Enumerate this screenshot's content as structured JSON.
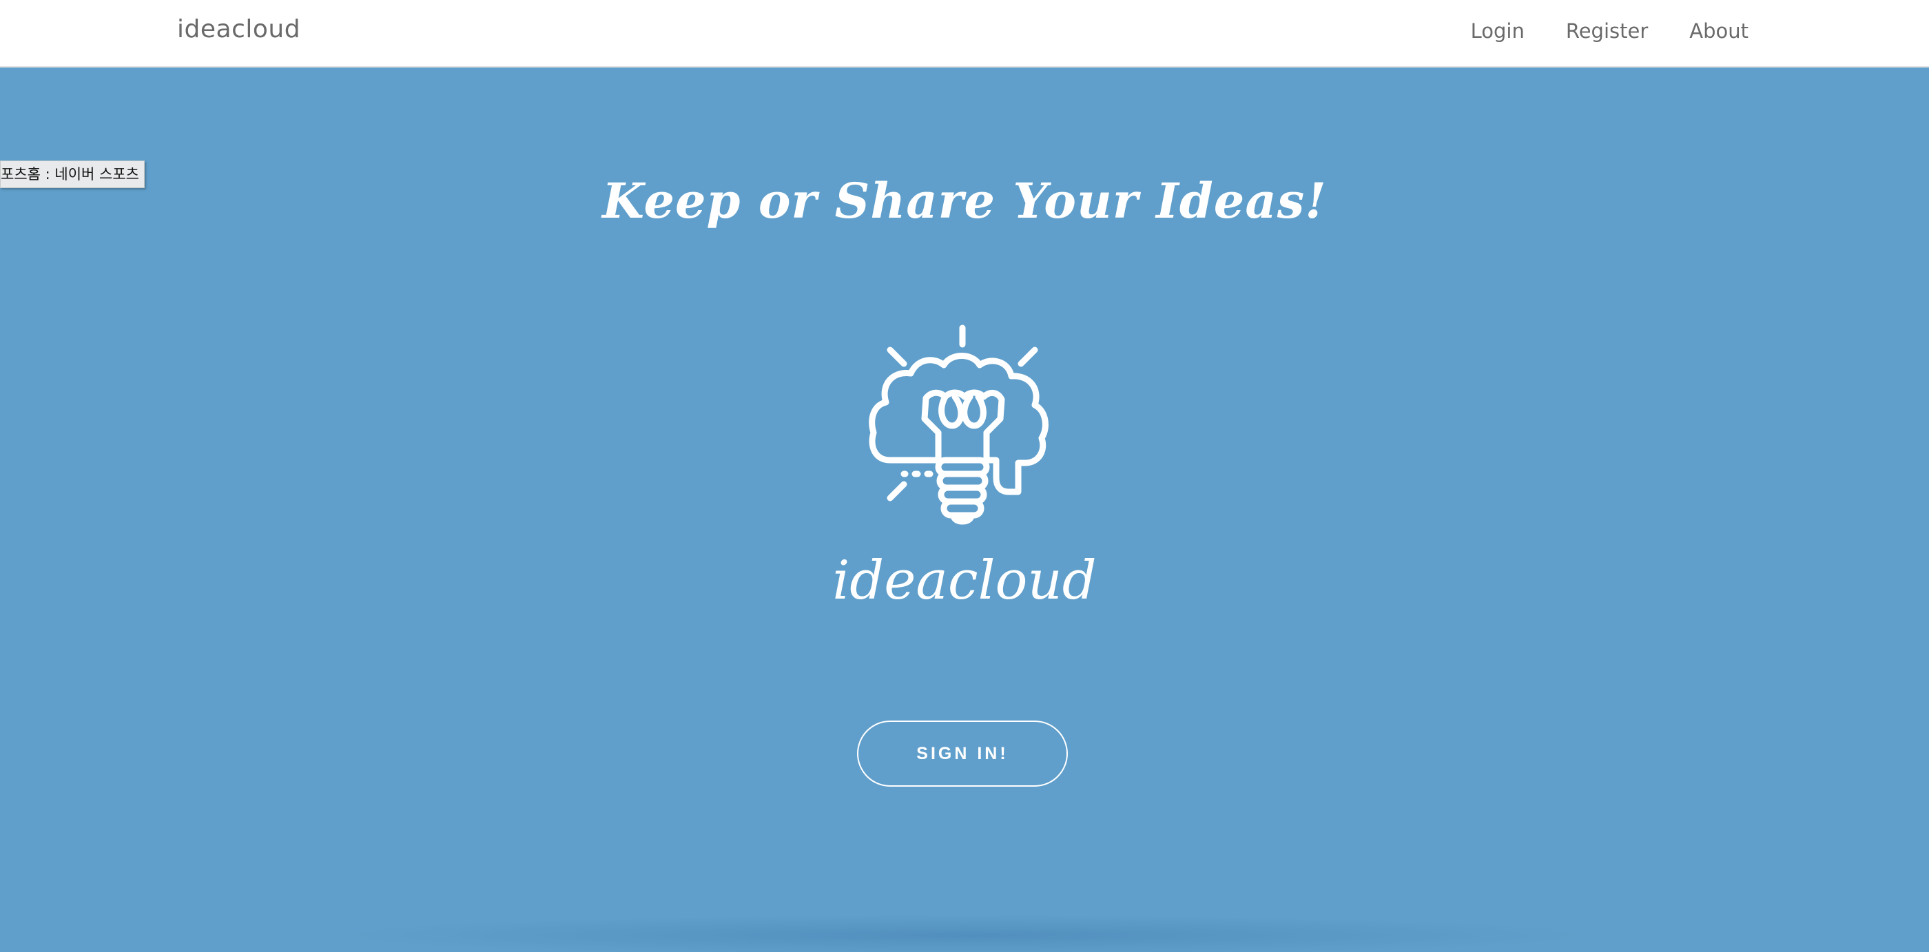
{
  "navbar": {
    "brand": "ideacloud",
    "links": [
      {
        "label": "Login"
      },
      {
        "label": "Register"
      },
      {
        "label": "About"
      }
    ]
  },
  "tooltip": {
    "text": "포츠홈 : 네이버 스포츠"
  },
  "hero": {
    "headline": "Keep or Share Your Ideas!",
    "logo_icon": "lightbulb-brain-cloud-icon",
    "logo_text": "ideacloud",
    "cta_label": "SIGN IN!"
  },
  "colors": {
    "hero_background": "#609fcb",
    "nav_text": "#6a6a6a",
    "foreground": "#ffffff"
  }
}
